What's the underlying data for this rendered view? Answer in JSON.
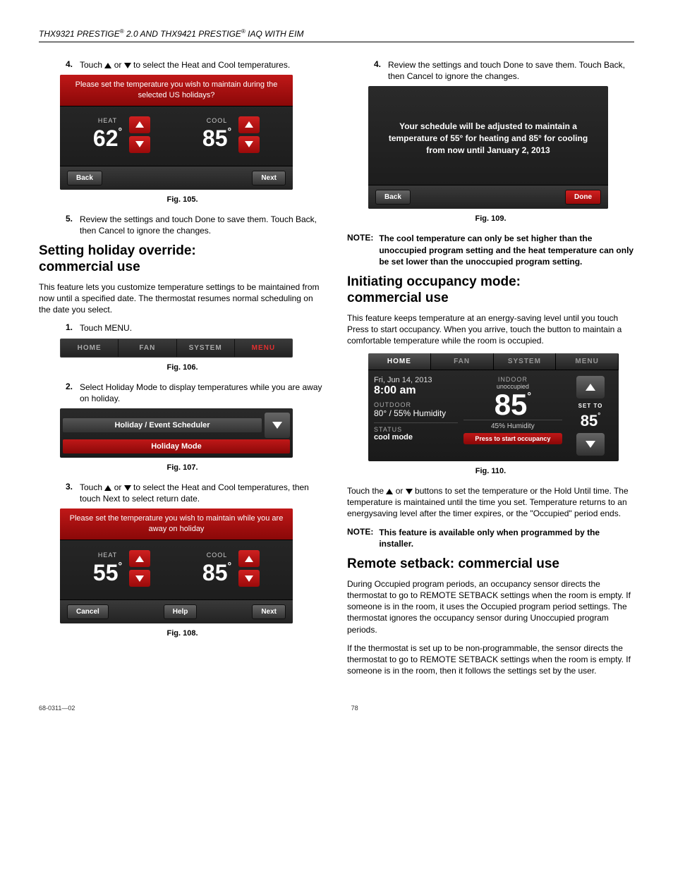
{
  "header": {
    "text_a": "THX9321 PRESTIGE",
    "reg": "®",
    "text_b": " 2.0 AND THX9421 PRESTIGE",
    "text_c": " IAQ WITH EIM"
  },
  "left": {
    "step4": {
      "num": "4.",
      "text_a": "Touch ",
      "text_b": " or ",
      "text_c": " to select the Heat and Cool temperatures."
    },
    "fig105": {
      "prompt": "Please set the temperature you wish to maintain during the selected US holidays?",
      "heat_label": "HEAT",
      "heat_value": "62",
      "deg": "°",
      "cool_label": "COOL",
      "cool_value": "85",
      "back": "Back",
      "next": "Next",
      "caption": "Fig. 105."
    },
    "step5": {
      "num": "5.",
      "text": "Review the settings and touch Done to save them. Touch Back, then Cancel to ignore the changes."
    },
    "sec1_title_a": "Setting holiday override:",
    "sec1_title_b": "commercial use",
    "sec1_body": "This feature lets you customize temperature settings to be maintained from now until a specified date. The thermostat resumes normal scheduling on the date you select.",
    "step1": {
      "num": "1.",
      "text": "Touch MENU."
    },
    "fig106": {
      "tabs": [
        "HOME",
        "FAN",
        "SYSTEM",
        "MENU"
      ],
      "active": 3,
      "caption": "Fig. 106."
    },
    "step2": {
      "num": "2.",
      "text": "Select Holiday Mode to display temperatures while you are away on holiday."
    },
    "fig107": {
      "title": "Holiday / Event Scheduler",
      "item": "Holiday Mode",
      "caption": "Fig. 107."
    },
    "step3": {
      "num": "3.",
      "text_a": "Touch ",
      "text_b": " or ",
      "text_c": " to select the Heat and Cool temperatures, then touch Next to select return date."
    },
    "fig108": {
      "prompt": "Please set the temperature you wish to maintain while you are away on holiday",
      "heat_label": "HEAT",
      "heat_value": "55",
      "deg": "°",
      "cool_label": "COOL",
      "cool_value": "85",
      "cancel": "Cancel",
      "help": "Help",
      "next": "Next",
      "caption": "Fig. 108."
    }
  },
  "right": {
    "step4": {
      "num": "4.",
      "text": "Review the settings and touch Done to save them. Touch Back, then Cancel to ignore the changes."
    },
    "fig109": {
      "msg": "Your schedule will be adjusted to maintain a temperature of 55° for heating and 85° for cooling from now until January 2, 2013",
      "back": "Back",
      "done": "Done",
      "caption": "Fig. 109."
    },
    "note1": {
      "label": "NOTE:",
      "text": "The cool temperature can only be set higher than the unoccupied program setting and the heat temperature can only be set lower than the unoccupied program setting."
    },
    "sec2_title_a": "Initiating occupancy mode:",
    "sec2_title_b": "commercial use",
    "sec2_body": "This feature keeps temperature at an energy-saving level until you touch Press to start occupancy. When you arrive, touch the button to maintain a comfortable temperature while the room is occupied.",
    "fig110": {
      "tabs": [
        "HOME",
        "FAN",
        "SYSTEM",
        "MENU"
      ],
      "date": "Fri, Jun 14, 2013",
      "time": "8:00 am",
      "outdoor_label": "OUTDOOR",
      "outdoor_value": "80° / 55% Humidity",
      "status_label": "STATUS",
      "status_value": "cool mode",
      "indoor_label": "INDOOR",
      "indoor_sub": "unoccupied",
      "indoor_temp": "85",
      "humidity": "45% Humidity",
      "press": "Press to start occupancy",
      "setto_label": "SET TO",
      "setto_value": "85",
      "deg": "°",
      "caption": "Fig. 110."
    },
    "post110_a": "Touch the ",
    "post110_b": " or ",
    "post110_c": " buttons to set the temperature or the Hold Until time. The temperature is maintained until the time you set. Temperature returns to an energysaving level after the timer expires, or the \"Occupied\" period ends.",
    "note2": {
      "label": "NOTE:",
      "text": "This feature is available only when programmed by the installer."
    },
    "sec3_title": "Remote setback: commercial use",
    "sec3_p1": "During Occupied program periods, an occupancy sensor directs the thermostat to go to REMOTE SETBACK settings when the room is empty. If someone is in the room, it uses the Occupied program period settings. The thermostat ignores the occupancy sensor during Unoccupied program periods.",
    "sec3_p2": "If the thermostat is set up to be non-programmable, the sensor directs the thermostat to go to REMOTE SETBACK settings when the room is empty. If someone is in the room, then it follows the settings set by the user."
  },
  "footer": {
    "left": "68-0311—02",
    "center": "78"
  }
}
